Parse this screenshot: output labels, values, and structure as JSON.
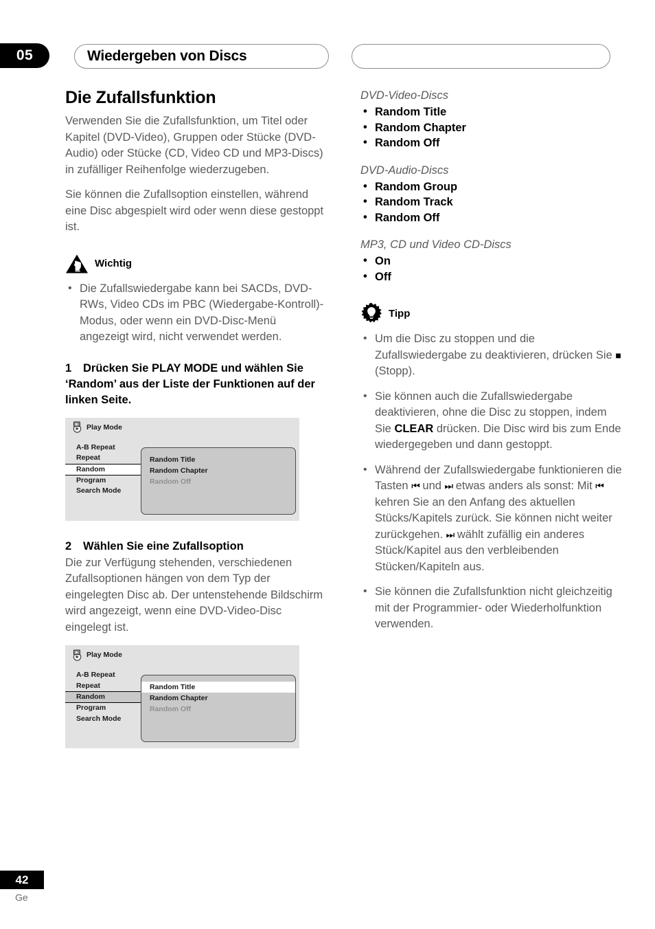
{
  "header": {
    "chapter_number": "05",
    "chapter_title": "Wiedergeben von Discs"
  },
  "left_column": {
    "section_title": "Die Zufallsfunktion",
    "intro_paragraph_1": "Verwenden Sie die Zufallsfunktion, um Titel oder Kapitel (DVD-Video), Gruppen oder Stücke (DVD-Audio) oder Stücke (CD, Video CD und MP3-Discs) in zufälliger Reihenfolge wiederzugeben.",
    "intro_paragraph_2": "Sie können die Zufallsoption einstellen, während eine Disc abgespielt wird oder wenn diese gestoppt ist.",
    "wichtig": {
      "icon": "warning-hand-triangle-icon",
      "label": "Wichtig",
      "bullets": [
        "Die Zufallswiedergabe kann bei SACDs, DVD-RWs, Video CDs im PBC (Wiedergabe-Kontroll)-Modus, oder wenn ein DVD-Disc-Menü angezeigt wird, nicht verwendet werden."
      ]
    },
    "step_1": {
      "number": "1",
      "text": "Drücken Sie PLAY MODE und wählen Sie ‘Random’ aus der Liste der Funktionen auf der linken Seite."
    },
    "step_2": {
      "number": "2",
      "text": "Wählen Sie eine Zufallsoption"
    },
    "step_2_body": "Die zur Verfügung stehenden, verschiedenen Zufallsoptionen hängen von dem Typ der eingelegten Disc ab. Der untenstehende Bildschirm wird angezeigt, wenn eine DVD-Video-Disc eingelegt ist."
  },
  "osd_screen_1": {
    "icon": "play-mode-disc-icon",
    "title": "Play Mode",
    "menu_items": [
      {
        "label": "A-B Repeat",
        "state": "normal"
      },
      {
        "label": "Repeat",
        "state": "normal"
      },
      {
        "label": "Random",
        "state": "selected-white"
      },
      {
        "label": "Program",
        "state": "normal"
      },
      {
        "label": "Search Mode",
        "state": "normal"
      }
    ],
    "panel_items": [
      {
        "label": "Random Title",
        "state": "normal"
      },
      {
        "label": "Random Chapter",
        "state": "normal"
      },
      {
        "label": "Random Off",
        "state": "dimmed"
      }
    ]
  },
  "osd_screen_2": {
    "icon": "play-mode-disc-icon",
    "title": "Play Mode",
    "menu_items": [
      {
        "label": "A-B Repeat",
        "state": "normal"
      },
      {
        "label": "Repeat",
        "state": "normal"
      },
      {
        "label": "Random",
        "state": "selected-grey"
      },
      {
        "label": "Program",
        "state": "normal"
      },
      {
        "label": "Search Mode",
        "state": "normal"
      }
    ],
    "panel_items": [
      {
        "label": "Random Title",
        "state": "highlighted"
      },
      {
        "label": "Random Chapter",
        "state": "normal"
      },
      {
        "label": "Random Off",
        "state": "dimmed"
      }
    ]
  },
  "right_column": {
    "disc_groups": [
      {
        "heading": "DVD-Video-Discs",
        "options": [
          "Random Title",
          "Random Chapter",
          "Random Off"
        ]
      },
      {
        "heading": "DVD-Audio-Discs",
        "options": [
          "Random Group",
          "Random Track",
          "Random Off"
        ]
      },
      {
        "heading": "MP3, CD und Video CD-Discs",
        "options": [
          "On",
          "Off"
        ]
      }
    ],
    "tipp": {
      "icon": "lightbulb-starburst-icon",
      "label": "Tipp",
      "bullets": [
        {
          "parts": [
            {
              "type": "text",
              "value": "Um die Disc zu stoppen und die Zufallswiedergabe zu deaktivieren, drücken Sie "
            },
            {
              "type": "symbol",
              "value": "■"
            },
            {
              "type": "text",
              "value": " (Stopp)."
            }
          ]
        },
        {
          "parts": [
            {
              "type": "text",
              "value": "Sie können auch die Zufallswiedergabe deaktivieren, ohne die Disc zu stoppen, indem Sie "
            },
            {
              "type": "bold",
              "value": "CLEAR"
            },
            {
              "type": "text",
              "value": " drücken. Die Disc wird bis zum Ende wiedergegeben und dann gestoppt."
            }
          ]
        },
        {
          "parts": [
            {
              "type": "text",
              "value": "Während der Zufallswiedergabe funktionieren die Tasten "
            },
            {
              "type": "symbol",
              "value": "⏮"
            },
            {
              "type": "text",
              "value": " und "
            },
            {
              "type": "symbol",
              "value": "⏭"
            },
            {
              "type": "text",
              "value": " etwas anders als sonst: Mit "
            },
            {
              "type": "symbol",
              "value": "⏮"
            },
            {
              "type": "text",
              "value": " kehren Sie an den Anfang des aktuellen Stücks/Kapitels zurück. Sie können nicht weiter zurückgehen. "
            },
            {
              "type": "symbol",
              "value": "⏭"
            },
            {
              "type": "text",
              "value": " wählt zufällig ein anderes Stück/Kapitel aus den verbleibenden Stücken/Kapiteln aus."
            }
          ]
        },
        {
          "parts": [
            {
              "type": "text",
              "value": "Sie können die Zufallsfunktion nicht gleichzeitig mit der Programmier- oder Wiederholfunktion verwenden."
            }
          ]
        }
      ]
    }
  },
  "footer": {
    "page_number": "42",
    "language_code": "Ge"
  }
}
